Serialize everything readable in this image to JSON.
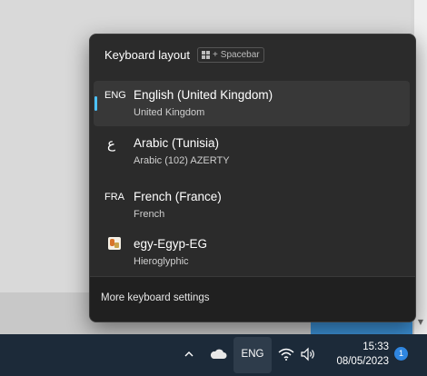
{
  "flyout": {
    "title": "Keyboard layout",
    "shortcut_plus": "+",
    "shortcut_key": "Spacebar",
    "items": [
      {
        "code": "ENG",
        "name": "English (United Kingdom)",
        "sub": "United Kingdom",
        "selected": true
      },
      {
        "code": "ع",
        "name": "Arabic (Tunisia)",
        "sub": "Arabic (102) AZERTY",
        "selected": false
      },
      {
        "code": "FRA",
        "name": "French (France)",
        "sub": "French",
        "selected": false
      },
      {
        "code": "",
        "icon": "hieroglyphic-ime-icon",
        "name": "egy-Egyp-EG",
        "sub": "Hieroglyphic",
        "selected": false
      }
    ],
    "footer_link": "More keyboard settings"
  },
  "taskbar": {
    "lang": "ENG",
    "time": "15:33",
    "date": "08/05/2023",
    "notification_count": "1"
  },
  "colors": {
    "accent": "#4cc2ff",
    "flyout_bg": "#2b2b2b",
    "taskbar_bg": "#1c2a39",
    "badge": "#2f86e0"
  }
}
